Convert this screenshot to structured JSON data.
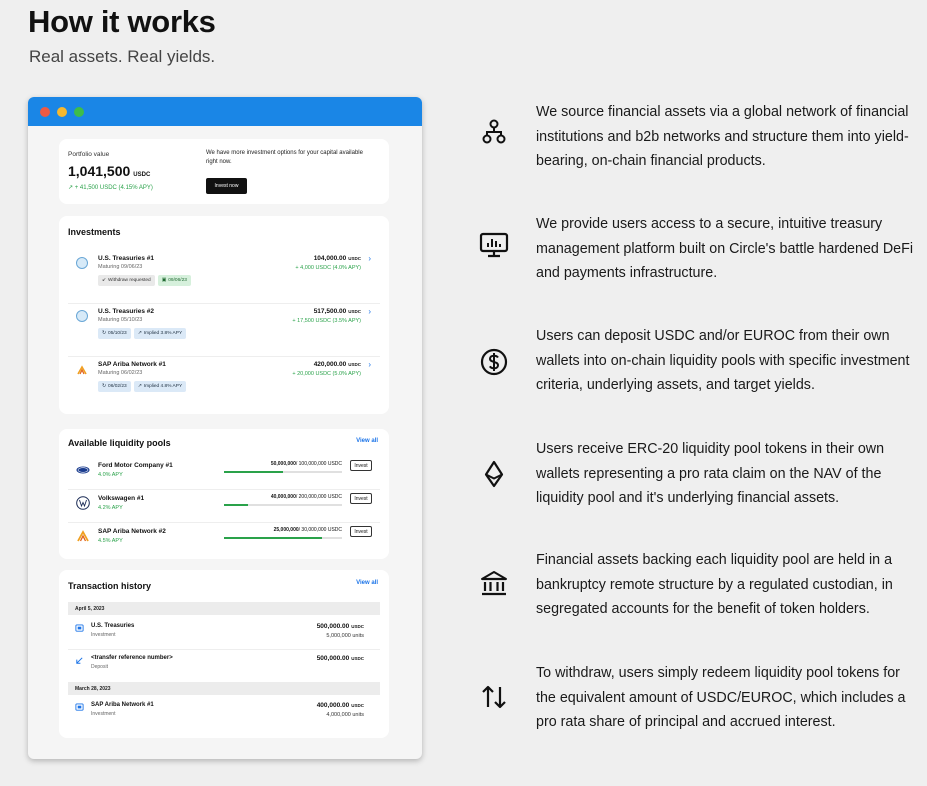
{
  "heading": "How it works",
  "subheading": "Real assets. Real yields.",
  "portfolio": {
    "label": "Portfolio value",
    "value": "1,041,500",
    "unit": "USDC",
    "gain": "+ 41,500 USDC (4.15% APY)",
    "message": "We have more investment options for your capital available right now.",
    "invest_button": "Invest now"
  },
  "investments": {
    "title": "Investments",
    "items": [
      {
        "name": "U.S. Treasuries #1",
        "maturity": "Maturing 09/06/23",
        "amount": "104,000.00",
        "unit": "USDC",
        "gain": "+ 4,000 USDC (4.0% APY)",
        "tags": [
          "Withdraw requested",
          "09/06/23"
        ]
      },
      {
        "name": "U.S. Treasuries #2",
        "maturity": "Maturing 05/10/23",
        "amount": "517,500.00",
        "unit": "USDC",
        "gain": "+ 17,500 USDC (3.5% APY)",
        "tags": [
          "05/10/23",
          "Implied 3.8% APY"
        ]
      },
      {
        "name": "SAP Ariba Network #1",
        "maturity": "Maturing 06/02/23",
        "amount": "420,000.00",
        "unit": "USDC",
        "gain": "+ 20,000 USDC (5.0% APY)",
        "tags": [
          "06/02/23",
          "Implied 4.8% APY"
        ]
      }
    ]
  },
  "pools": {
    "title": "Available liquidity pools",
    "view_all": "View all",
    "invest_label": "Invest",
    "items": [
      {
        "name": "Ford Motor Company #1",
        "apy": "4.0% APY",
        "raised": "50,000,000",
        "total": "/ 100,000,000 USDC",
        "progress": 0.5
      },
      {
        "name": "Volkswagen #1",
        "apy": "4.2% APY",
        "raised": "40,000,000",
        "total": "/ 200,000,000 USDC",
        "progress": 0.2
      },
      {
        "name": "SAP Ariba Network #2",
        "apy": "4.5% APY",
        "raised": "25,000,000",
        "total": "/ 30,000,000 USDC",
        "progress": 0.83
      }
    ]
  },
  "transactions": {
    "title": "Transaction history",
    "view_all": "View all",
    "date1": "April 5, 2023",
    "date2": "March 28, 2023",
    "items": [
      {
        "name": "U.S. Treasuries",
        "type": "Investment",
        "amount": "500,000.00",
        "unit": "USDC",
        "units": "5,000,000 units"
      },
      {
        "name": "<transfer reference number>",
        "type": "Deposit",
        "amount": "500,000.00",
        "unit": "USDC",
        "units": ""
      },
      {
        "name": "SAP Ariba Network #1",
        "type": "Investment",
        "amount": "400,000.00",
        "unit": "USDC",
        "units": "4,000,000 units"
      }
    ]
  },
  "features": [
    {
      "icon": "network-icon",
      "text": "We source  financial assets via a global network of financial institutions and b2b networks and structure them into yield-bearing, on-chain financial products."
    },
    {
      "icon": "monitor-chart-icon",
      "text": "We provide users access to a secure, intuitive treasury management platform built on Circle's battle hardened DeFi and payments infrastructure."
    },
    {
      "icon": "dollar-circle-icon",
      "text": "Users can deposit USDC and/or EUROC from their own wallets into on-chain liquidity pools with specific investment criteria, underlying assets,  and target yields."
    },
    {
      "icon": "ethereum-icon",
      "text": "Users receive ERC-20 liquidity pool tokens in their own wallets representing a pro rata claim on the NAV of the liquidity pool and it's underlying financial assets."
    },
    {
      "icon": "bank-icon",
      "text": "Financial assets backing each liquidity pool are held in a bankruptcy remote structure by a regulated custodian, in segregated accounts for the benefit of token holders."
    },
    {
      "icon": "swap-arrows-icon",
      "text": "To withdraw, users simply redeem liquidity pool tokens for the equivalent amount of USDC/EUROC, which includes a pro rata share of principal and accrued interest."
    }
  ],
  "colors": {
    "accent": "#1a86e6",
    "positive": "#2aa24a",
    "link": "#1a73e8"
  }
}
